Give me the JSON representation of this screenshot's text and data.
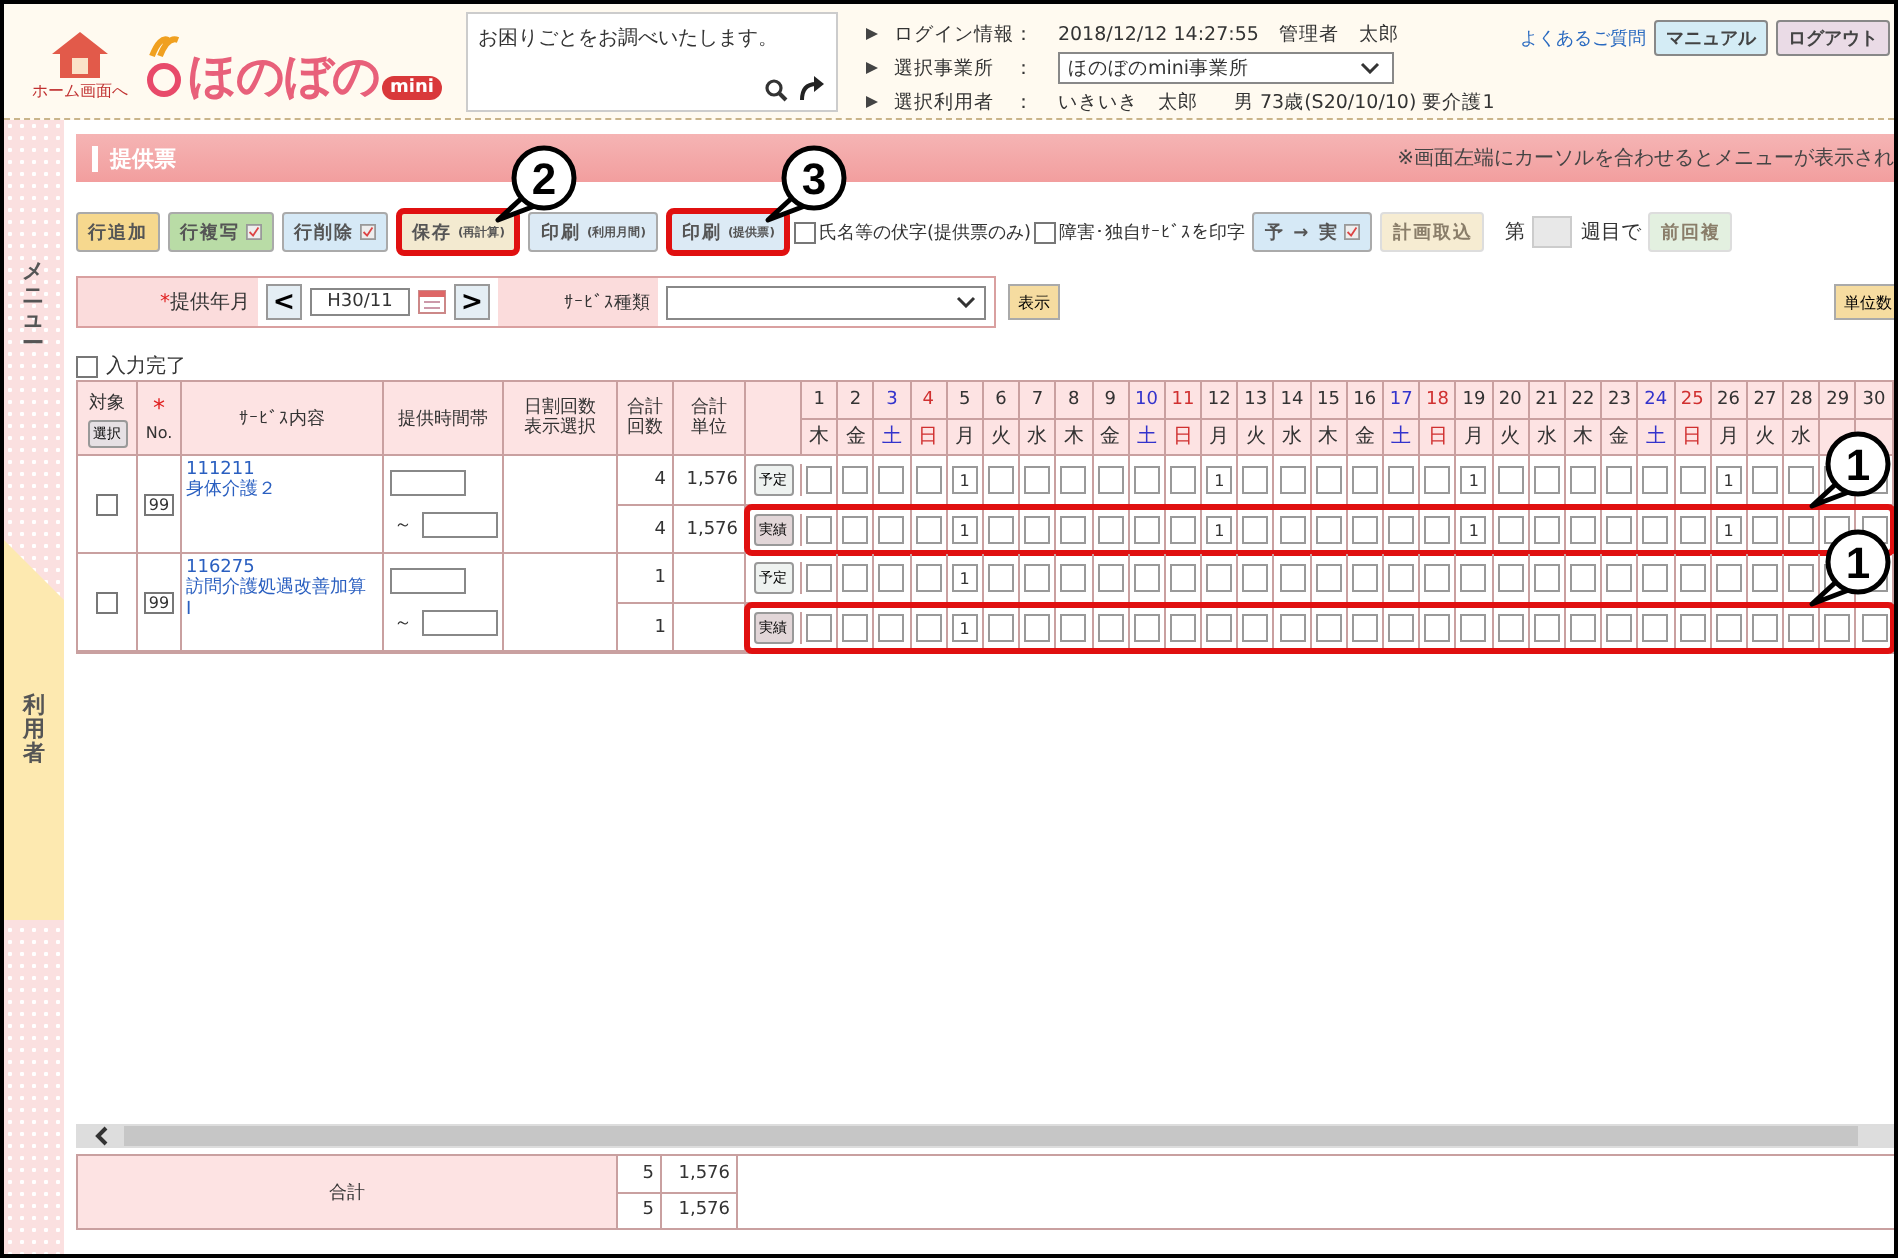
{
  "header": {
    "home_label": "ホーム画面へ",
    "logo_text": "ほのぼの",
    "logo_badge": "mini",
    "search_text": "お困りごとをお調べいたします。",
    "info": [
      {
        "kind": "text",
        "label": "ログイン情報：",
        "value": "2018/12/12 14:27:55　管理者　太郎"
      },
      {
        "kind": "select",
        "label": "選択事業所　：",
        "value": "ほのぼのmini事業所"
      },
      {
        "kind": "text",
        "label": "選択利用者　：",
        "value": "いきいき　太郎",
        "extra": "男 73歳(S20/10/10) 要介護1"
      }
    ],
    "faq_link": "よくあるご質問",
    "buttons": [
      {
        "label": "マニュアル",
        "kind": "manual"
      },
      {
        "label": "ログアウト",
        "kind": "logout"
      }
    ]
  },
  "sidebar": {
    "menu_label": "メニュー",
    "user_tab": "利用者"
  },
  "title": "提供票",
  "notice": "※画面左端にカーソルを合わせるとメニューが表示され",
  "toolbar": [
    {
      "kind": "button",
      "label": "行追加",
      "color": "#f6d88e",
      "check_icon": false,
      "highlighted": false,
      "disabled": false
    },
    {
      "kind": "button",
      "label": "行複写",
      "color": "#b9dca6",
      "check_icon": true,
      "highlighted": false,
      "disabled": false
    },
    {
      "kind": "button",
      "label": "行削除",
      "color": "#d6e9f6",
      "check_icon": true,
      "highlighted": false,
      "disabled": false
    },
    {
      "kind": "button",
      "label": "保存",
      "sub": "(再計算)",
      "color": "#f3ead0",
      "check_icon": false,
      "highlighted": true,
      "callout": "2",
      "disabled": false
    },
    {
      "kind": "button",
      "label": "印刷",
      "sub": "(利用月間)",
      "color": "#dceaf5",
      "check_icon": false,
      "highlighted": false,
      "disabled": false
    },
    {
      "kind": "button",
      "label": "印刷",
      "sub": "(提供票)",
      "color": "#dceaf5",
      "check_icon": false,
      "highlighted": true,
      "callout": "3",
      "disabled": false
    },
    {
      "kind": "checkbox",
      "label": "氏名等の伏字(提供票のみ)",
      "checked": false
    },
    {
      "kind": "checkbox",
      "label": "障害･独自ｻｰﾋﾞｽを印字",
      "checked": false
    },
    {
      "kind": "button",
      "label": "予 → 実",
      "color": "#d6e9f6",
      "check_icon": true,
      "highlighted": false,
      "disabled": false
    },
    {
      "kind": "button",
      "label": "計画取込",
      "color": "#f6ecd2",
      "check_icon": false,
      "highlighted": false,
      "disabled": true
    },
    {
      "kind": "week",
      "prefix": "第",
      "suffix": "週目で"
    },
    {
      "kind": "button",
      "label": "前回複",
      "color": "#e3f0e0",
      "check_icon": false,
      "highlighted": false,
      "disabled": true
    }
  ],
  "filter": {
    "month_label": "提供年月",
    "required_mark": "*",
    "month": "H30/11",
    "prev": "<",
    "next": ">",
    "type_label": "ｻｰﾋﾞｽ種類",
    "show_button": "表示",
    "units_button": "単位数"
  },
  "complete": {
    "label": "入力完了",
    "checked": false
  },
  "columns": {
    "target": "対象",
    "select_button": "選択",
    "no_mark": "*",
    "no": "No.",
    "service": "ｻｰﾋﾞｽ内容",
    "time": "提供時間帯",
    "daily": "日割回数表示選択",
    "count": "合計回数",
    "units": "合計単位"
  },
  "days": [
    {
      "day": "1",
      "weekday": "木",
      "kind": "weekday"
    },
    {
      "day": "2",
      "weekday": "金",
      "kind": "weekday"
    },
    {
      "day": "3",
      "weekday": "土",
      "kind": "saturday"
    },
    {
      "day": "4",
      "weekday": "日",
      "kind": "sunday"
    },
    {
      "day": "5",
      "weekday": "月",
      "kind": "weekday"
    },
    {
      "day": "6",
      "weekday": "火",
      "kind": "weekday"
    },
    {
      "day": "7",
      "weekday": "水",
      "kind": "weekday"
    },
    {
      "day": "8",
      "weekday": "木",
      "kind": "weekday"
    },
    {
      "day": "9",
      "weekday": "金",
      "kind": "weekday"
    },
    {
      "day": "10",
      "weekday": "土",
      "kind": "saturday"
    },
    {
      "day": "11",
      "weekday": "日",
      "kind": "sunday"
    },
    {
      "day": "12",
      "weekday": "月",
      "kind": "weekday"
    },
    {
      "day": "13",
      "weekday": "火",
      "kind": "weekday"
    },
    {
      "day": "14",
      "weekday": "水",
      "kind": "weekday"
    },
    {
      "day": "15",
      "weekday": "木",
      "kind": "weekday"
    },
    {
      "day": "16",
      "weekday": "金",
      "kind": "weekday"
    },
    {
      "day": "17",
      "weekday": "土",
      "kind": "saturday"
    },
    {
      "day": "18",
      "weekday": "日",
      "kind": "sunday"
    },
    {
      "day": "19",
      "weekday": "月",
      "kind": "weekday"
    },
    {
      "day": "20",
      "weekday": "火",
      "kind": "weekday"
    },
    {
      "day": "21",
      "weekday": "水",
      "kind": "weekday"
    },
    {
      "day": "22",
      "weekday": "木",
      "kind": "weekday"
    },
    {
      "day": "23",
      "weekday": "金",
      "kind": "weekday"
    },
    {
      "day": "24",
      "weekday": "土",
      "kind": "saturday"
    },
    {
      "day": "25",
      "weekday": "日",
      "kind": "sunday"
    },
    {
      "day": "26",
      "weekday": "月",
      "kind": "weekday"
    },
    {
      "day": "27",
      "weekday": "火",
      "kind": "weekday"
    },
    {
      "day": "28",
      "weekday": "水",
      "kind": "weekday"
    },
    {
      "day": "29",
      "kind": "weekday"
    },
    {
      "day": "30",
      "kind": "weekday"
    }
  ],
  "services": [
    {
      "checked": false,
      "no": "99",
      "code": "111211",
      "name": "身体介護２",
      "time_separator": "～",
      "rows": [
        {
          "count": "4",
          "units": "1,576",
          "button": "予定",
          "kind": "plan",
          "highlighted": false,
          "cells": [
            {},
            {},
            {},
            {},
            {
              "value": "1"
            },
            {},
            {},
            {},
            {},
            {},
            {},
            {
              "value": "1"
            },
            {},
            {},
            {},
            {},
            {},
            {},
            {
              "value": "1"
            },
            {},
            {},
            {},
            {},
            {},
            {},
            {
              "value": "1"
            },
            {},
            {},
            {},
            {}
          ]
        },
        {
          "count": "4",
          "units": "1,576",
          "button": "実績",
          "kind": "actual",
          "highlighted": true,
          "callout": "1",
          "cells": [
            {},
            {},
            {},
            {},
            {
              "value": "1"
            },
            {},
            {},
            {},
            {},
            {},
            {},
            {
              "value": "1"
            },
            {},
            {},
            {},
            {},
            {},
            {},
            {
              "value": "1"
            },
            {},
            {},
            {},
            {},
            {},
            {},
            {
              "value": "1"
            },
            {},
            {},
            {},
            {}
          ]
        }
      ]
    },
    {
      "checked": false,
      "no": "99",
      "code": "116275",
      "name": "訪問介護処遇改善加算Ⅰ",
      "time_separator": "～",
      "rows": [
        {
          "count": "1",
          "button": "予定",
          "kind": "plan",
          "highlighted": false,
          "cells": [
            {},
            {},
            {},
            {},
            {
              "value": "1"
            },
            {},
            {},
            {},
            {},
            {},
            {},
            {},
            {},
            {},
            {},
            {},
            {},
            {},
            {},
            {},
            {},
            {},
            {},
            {},
            {},
            {},
            {},
            {},
            {},
            {}
          ]
        },
        {
          "count": "1",
          "button": "実績",
          "kind": "actual",
          "highlighted": true,
          "callout": "1",
          "cells": [
            {},
            {},
            {},
            {},
            {
              "value": "1"
            },
            {},
            {},
            {},
            {},
            {},
            {},
            {},
            {},
            {},
            {},
            {},
            {},
            {},
            {},
            {},
            {},
            {},
            {},
            {},
            {},
            {},
            {},
            {},
            {},
            {}
          ]
        }
      ]
    }
  ],
  "totals": {
    "label": "合計",
    "rows": [
      {
        "count": "5",
        "units": "1,576"
      },
      {
        "count": "5",
        "units": "1,576"
      }
    ]
  }
}
